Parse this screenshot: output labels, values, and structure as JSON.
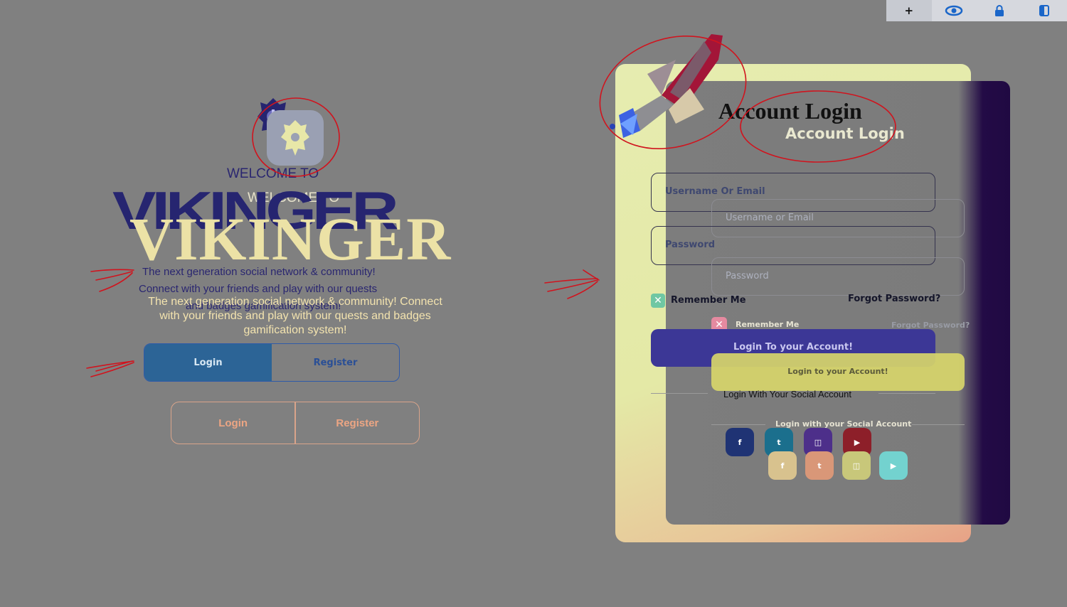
{
  "toolbar": {
    "buttons": [
      {
        "icon": "plus-icon",
        "glyph": "+"
      },
      {
        "icon": "eye-icon",
        "glyph": "👁"
      },
      {
        "icon": "lock-icon",
        "glyph": "🔒"
      },
      {
        "icon": "sidebar-toggle-icon",
        "glyph": "◧"
      }
    ]
  },
  "left": {
    "welcome_navy": "WELCOME TO",
    "welcome_cream": "WELCOME TO",
    "brand_navy": "VIKINGER",
    "brand_cream": "VIKINGER",
    "tagline_navy_1": "The next generation social network & community!",
    "tagline_navy_2": "Connect with your friends and play with our quests",
    "tagline_navy_3": "and badges gamification system!",
    "tagline_cream": "The next generation social network & community! Connect with your friends and play with our quests and badges gamification system!",
    "tabs_primary": {
      "login": "Login",
      "register": "Register"
    },
    "tabs_secondary": {
      "login": "Login",
      "register": "Register"
    }
  },
  "right": {
    "title_serif": "Account Login",
    "title_light": "Account Login",
    "username_navy_placeholder": "Username Or Email",
    "username_light_placeholder": "Username or Email",
    "password_navy_placeholder": "Password",
    "password_light_placeholder": "Password",
    "remember_navy": "Remember Me",
    "forgot_navy": "Forgot Password?",
    "remember_light": "Remember Me",
    "forgot_light": "Forgot Password?",
    "login_btn_navy": "Login To your Account!",
    "login_btn_yellow": "Login to your Account!",
    "social_navy": "Login With Your Social Account",
    "social_light": "Login with your Social Account"
  },
  "social_navy_icons": [
    {
      "name": "facebook-icon",
      "glyph": "f",
      "color": "#1f3374"
    },
    {
      "name": "twitter-icon",
      "glyph": "t",
      "color": "#1b6f8d"
    },
    {
      "name": "twitch-icon",
      "glyph": "◫",
      "color": "#4d2f8a"
    },
    {
      "name": "youtube-icon",
      "glyph": "▶",
      "color": "#8d1f29"
    }
  ],
  "social_light_icons": [
    {
      "name": "facebook-icon",
      "glyph": "f",
      "color": "#d8c28e"
    },
    {
      "name": "twitter-icon",
      "glyph": "t",
      "color": "#d99778"
    },
    {
      "name": "twitch-icon",
      "glyph": "◫",
      "color": "#c8c77a"
    },
    {
      "name": "youtube-icon",
      "glyph": "▶",
      "color": "#73d2cf"
    }
  ],
  "colors": {
    "background": "#808080",
    "navy": "#262570",
    "cream": "#ece2a6",
    "annotation_red": "#d0141e"
  }
}
